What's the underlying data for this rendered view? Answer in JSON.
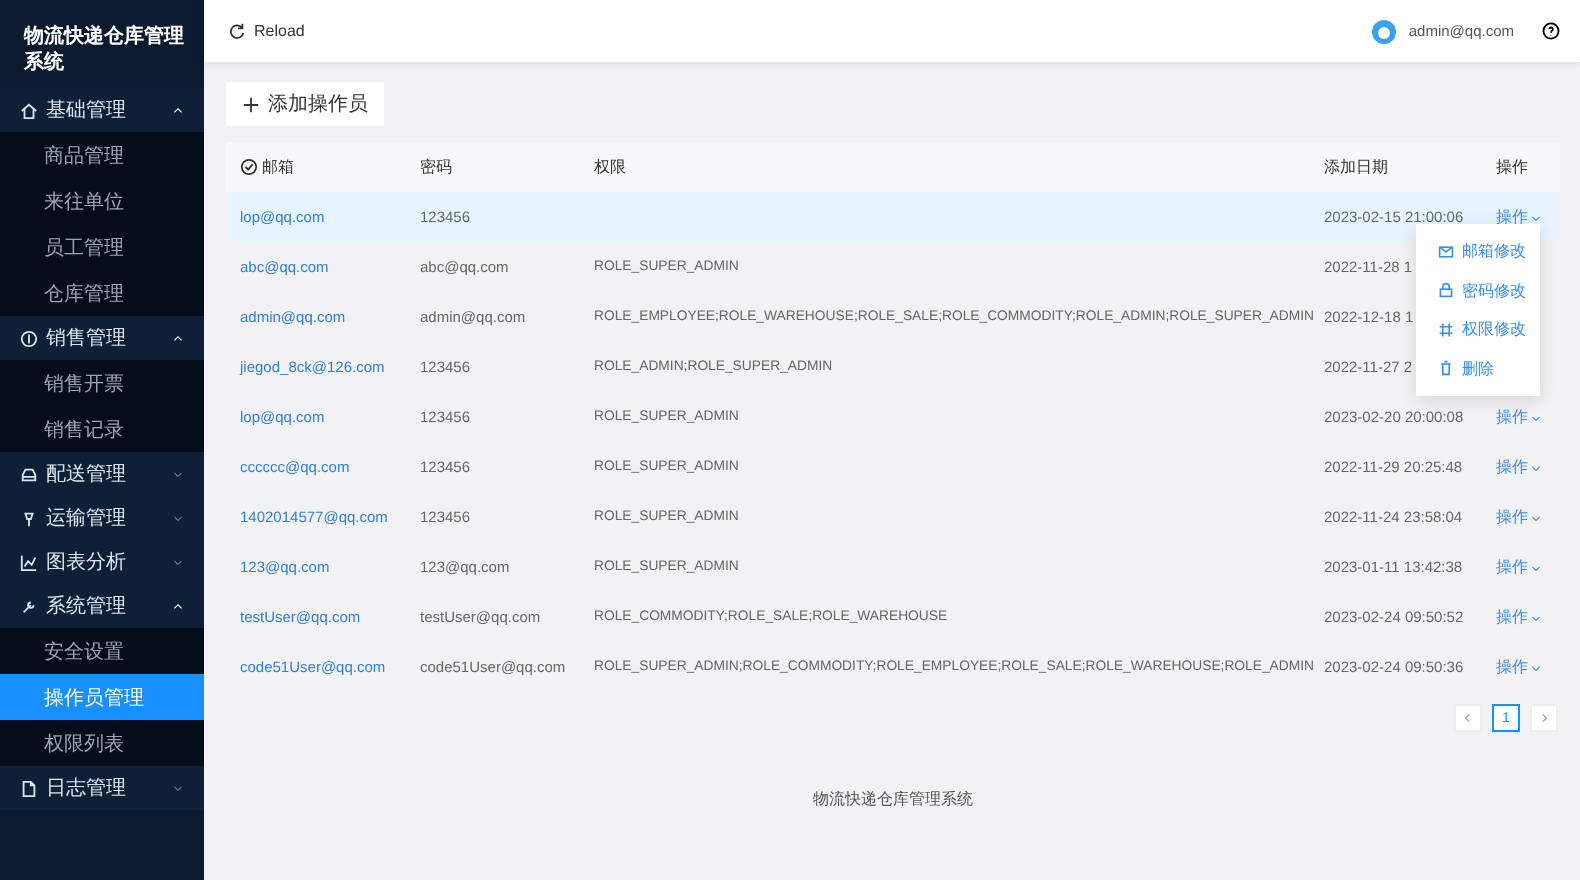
{
  "sidebar": {
    "title": "物流快递仓库管理系统",
    "groups": [
      {
        "label": "基础管理",
        "expanded": true,
        "items": [
          {
            "label": "商品管理",
            "selected": false
          },
          {
            "label": "来往单位",
            "selected": false
          },
          {
            "label": "员工管理",
            "selected": false
          },
          {
            "label": "仓库管理",
            "selected": false
          }
        ]
      },
      {
        "label": "销售管理",
        "expanded": true,
        "items": [
          {
            "label": "销售开票",
            "selected": false
          },
          {
            "label": "销售记录",
            "selected": false
          }
        ]
      },
      {
        "label": "配送管理",
        "expanded": false
      },
      {
        "label": "运输管理",
        "expanded": false
      },
      {
        "label": "图表分析",
        "expanded": false
      },
      {
        "label": "系统管理",
        "expanded": true,
        "items": [
          {
            "label": "安全设置",
            "selected": false
          },
          {
            "label": "操作员管理",
            "selected": true
          },
          {
            "label": "权限列表",
            "selected": false
          }
        ]
      },
      {
        "label": "日志管理",
        "expanded": false
      }
    ]
  },
  "header": {
    "reload": "Reload",
    "user": "admin@qq.com"
  },
  "add_button": "添加操作员",
  "table": {
    "columns": [
      "邮箱",
      "密码",
      "权限",
      "添加日期",
      "操作"
    ],
    "rows": [
      {
        "email": "lop@qq.com",
        "password": "123456",
        "date": "2023-02-15 21:00:06",
        "action": "操作",
        "selected": true
      },
      {
        "email": "abc@qq.com",
        "password": "abc@qq.com",
        "roles": "ROLE_SUPER_ADMIN",
        "date": "2022-11-28 1",
        "selected": false
      },
      {
        "email": "admin@qq.com",
        "password": "admin@qq.com",
        "roles": "ROLE_EMPLOYEE;ROLE_WAREHOUSE;ROLE_SALE;ROLE_COMMODITY;ROLE_ADMIN;ROLE_SUPER_ADMIN",
        "date": "2022-12-18 1",
        "selected": false
      },
      {
        "email": "jiegod_8ck@126.com",
        "password": "123456",
        "roles": "ROLE_ADMIN;ROLE_SUPER_ADMIN",
        "date": "2022-11-27 2",
        "selected": false
      },
      {
        "email": "lop@qq.com",
        "password": "123456",
        "roles": "ROLE_SUPER_ADMIN",
        "date": "2023-02-20 20:00:08",
        "action": "操作",
        "selected": false
      },
      {
        "email": "cccccc@qq.com",
        "password": "123456",
        "roles": "ROLE_SUPER_ADMIN",
        "date": "2022-11-29 20:25:48",
        "action": "操作",
        "selected": false
      },
      {
        "email": "1402014577@qq.com",
        "password": "123456",
        "roles": "ROLE_SUPER_ADMIN",
        "date": "2022-11-24 23:58:04",
        "action": "操作",
        "selected": false
      },
      {
        "email": "123@qq.com",
        "password": "123@qq.com",
        "roles": "ROLE_SUPER_ADMIN",
        "date": "2023-01-11 13:42:38",
        "action": "操作",
        "selected": false
      },
      {
        "email": "testUser@qq.com",
        "password": "testUser@qq.com",
        "roles": "ROLE_COMMODITY;ROLE_SALE;ROLE_WAREHOUSE",
        "date": "2023-02-24 09:50:52",
        "action": "操作",
        "selected": false
      },
      {
        "email": "code51User@qq.com",
        "password": "code51User@qq.com",
        "roles": "ROLE_SUPER_ADMIN;ROLE_COMMODITY;ROLE_EMPLOYEE;ROLE_SALE;ROLE_WAREHOUSE;ROLE_ADMIN",
        "date": "2023-02-24 09:50:36",
        "action": "操作",
        "selected": false
      }
    ]
  },
  "action_menu": {
    "items": [
      "邮箱修改",
      "密码修改",
      "权限修改",
      "删除"
    ]
  },
  "pagination": {
    "pages": [
      {
        "label": "1",
        "selected": true
      }
    ]
  },
  "footer": "物流快递仓库管理系统"
}
